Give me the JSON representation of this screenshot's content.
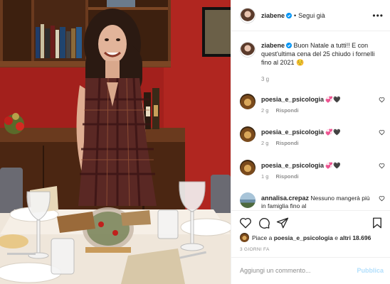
{
  "header": {
    "username": "ziabene",
    "separator": "•",
    "follow_label": "Segui già",
    "more_icon": "more-horizontal-icon",
    "more_label": "•••"
  },
  "caption": {
    "username": "ziabene",
    "text": "Buon Natale a tutti!! E con quest'ultima cena del 25 chiudo i fornelli fino al 2021 ☺️",
    "time": "3 g"
  },
  "comments": [
    {
      "username": "poesia_e_psicologia",
      "text": "💞🖤",
      "time": "2 g",
      "reply": "Rispondi"
    },
    {
      "username": "poesia_e_psicologia",
      "text": "💞🖤",
      "time": "2 g",
      "reply": "Rispondi"
    },
    {
      "username": "poesia_e_psicologia",
      "text": "💞🖤",
      "time": "1 g",
      "reply": "Rispondi"
    },
    {
      "username": "annalisa.crepaz",
      "text": "Nessuno mangerà più in famiglia fino al"
    }
  ],
  "actions": {
    "icons": [
      "heart-icon",
      "comment-icon",
      "share-icon",
      "bookmark-icon"
    ]
  },
  "likes": {
    "prefix": "Piace a",
    "user": "poesia_e_psicologia",
    "middle": "e",
    "others": "altri 18.696"
  },
  "post_age": "3 GIORNI FA",
  "add_comment": {
    "placeholder": "Aggiungi un commento...",
    "publish_label": "Pubblica"
  },
  "colors": {
    "wall": "#a3201c",
    "accent_blue": "#0095f6",
    "publish_disabled": "#b2dffc",
    "muted_text": "#8e8e8e"
  }
}
